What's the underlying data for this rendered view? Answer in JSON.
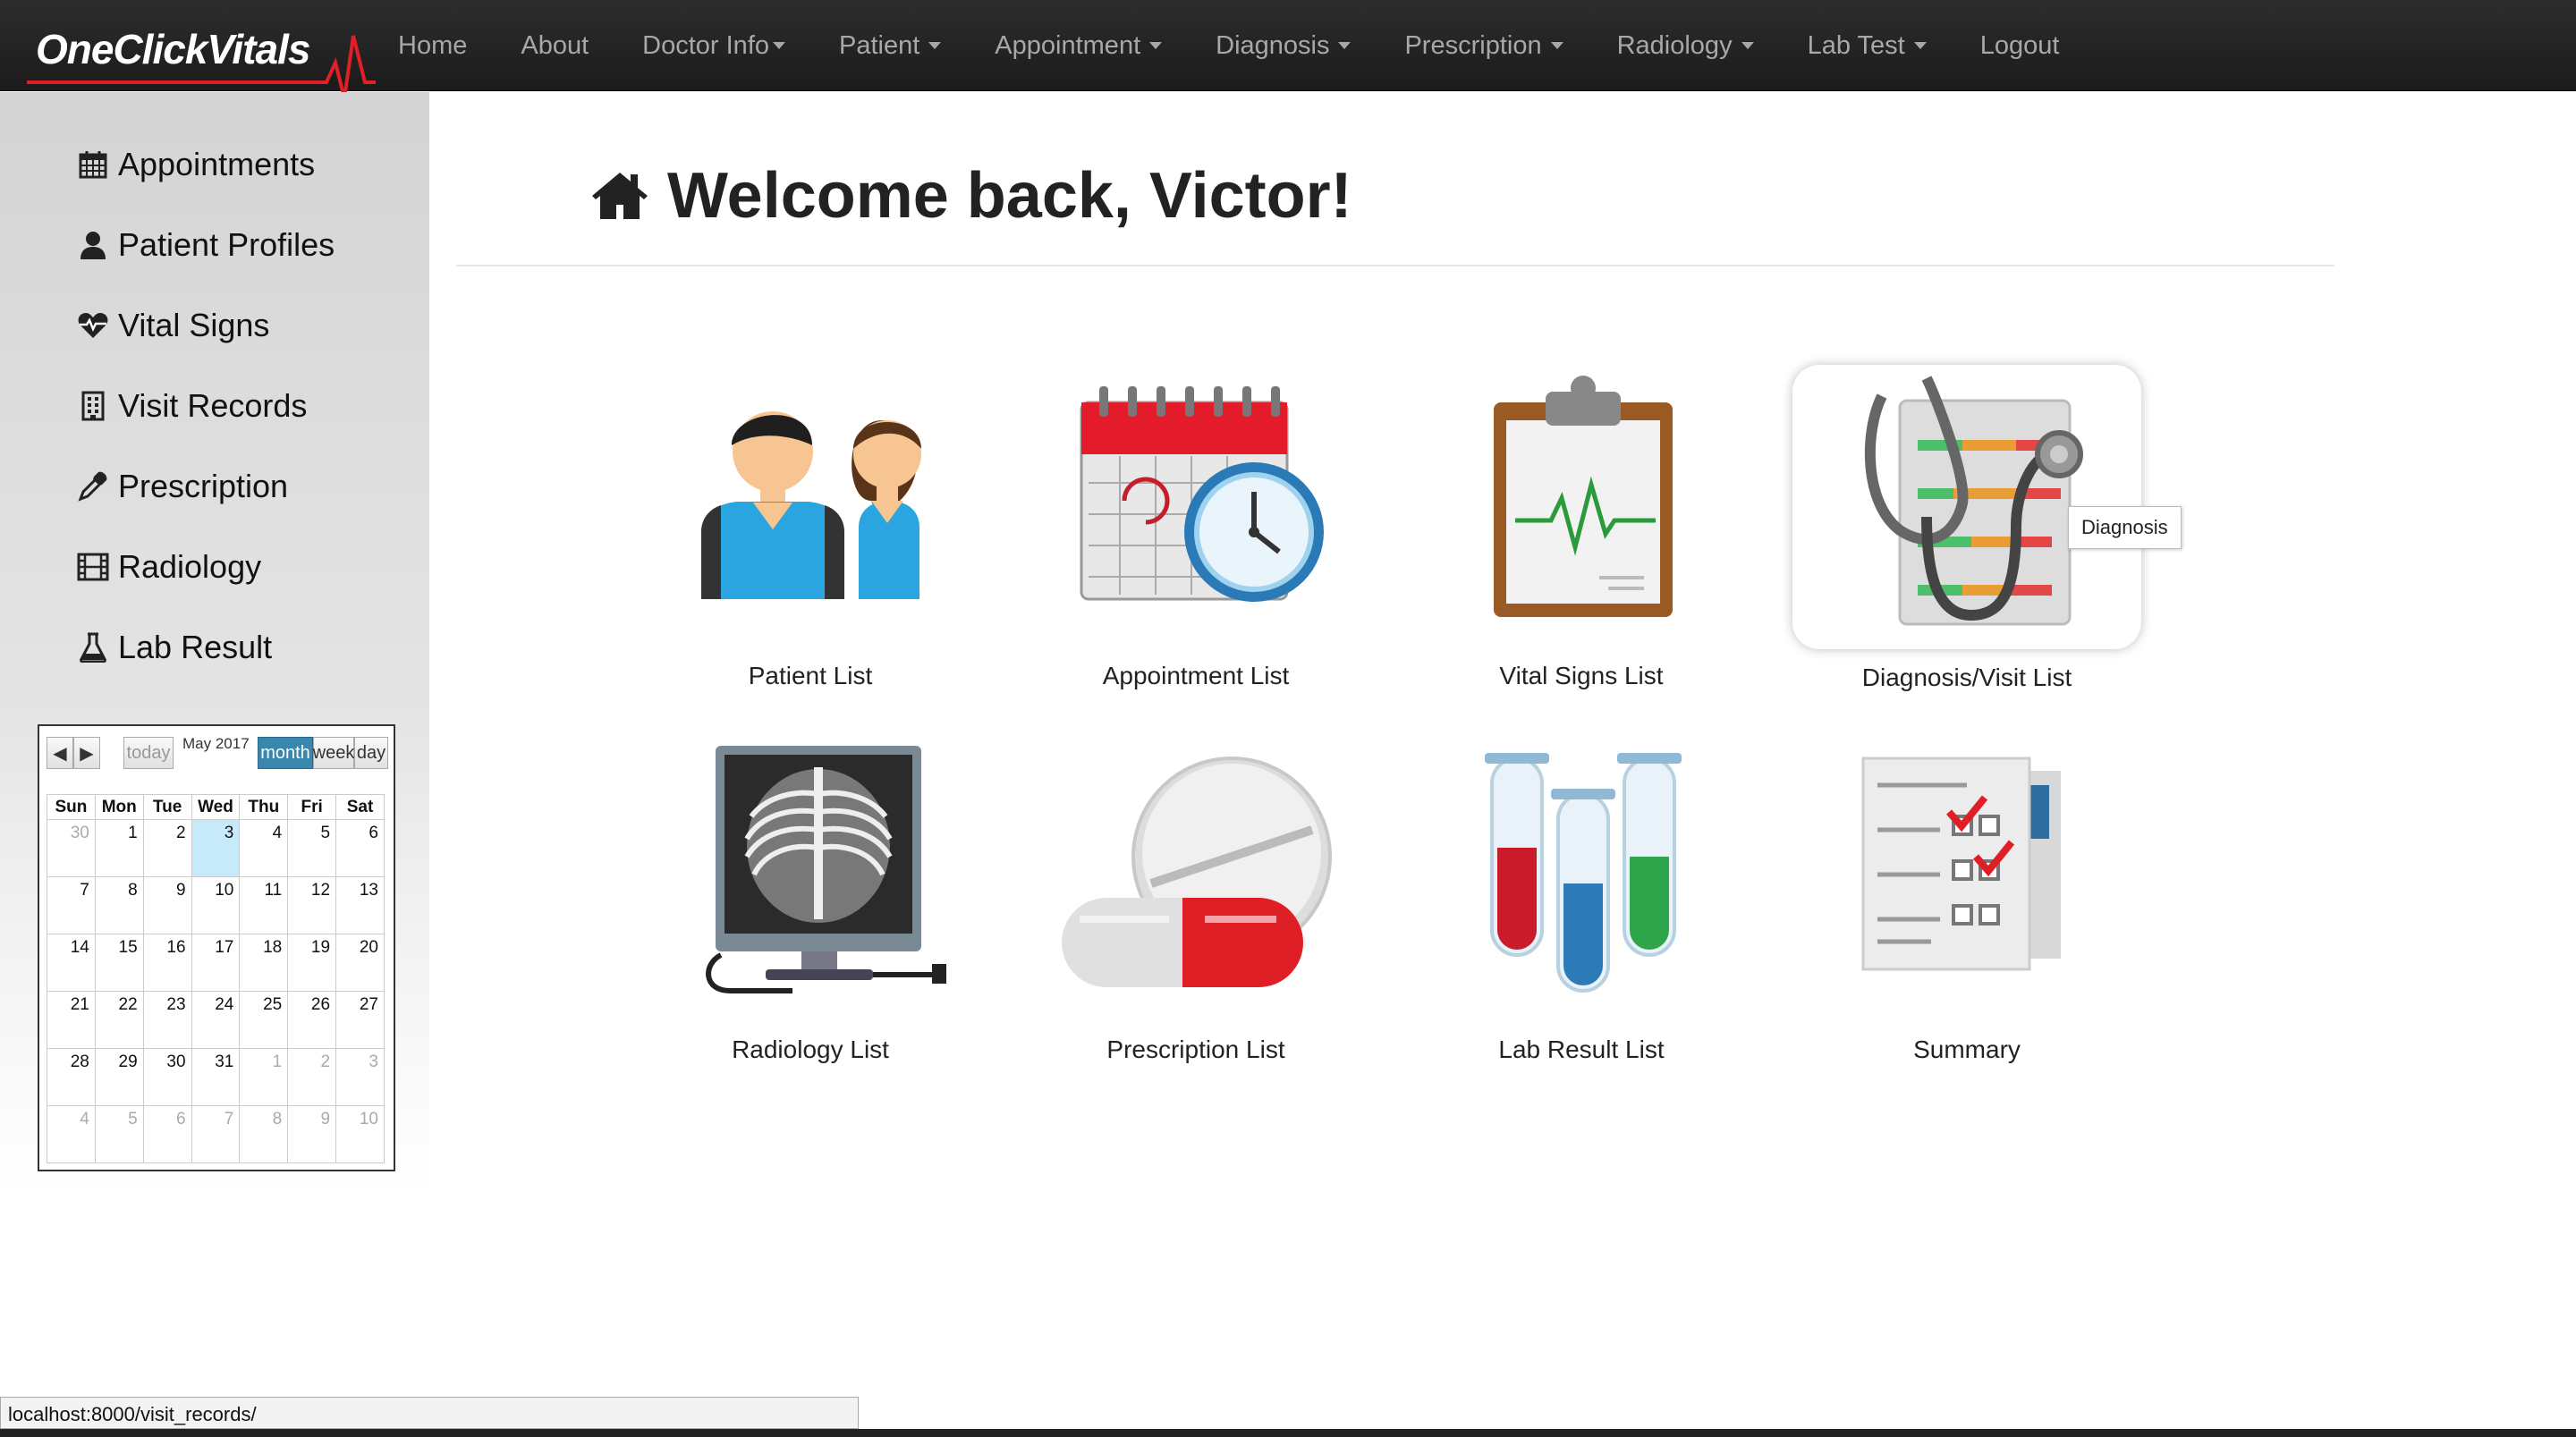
{
  "brand": {
    "name": "OneClickVitals"
  },
  "nav": {
    "items": [
      {
        "label": "Home",
        "dropdown": false
      },
      {
        "label": "About",
        "dropdown": false
      },
      {
        "label": "Doctor Info",
        "dropdown": true
      },
      {
        "label": "Patient",
        "dropdown": true
      },
      {
        "label": "Appointment",
        "dropdown": true
      },
      {
        "label": "Diagnosis",
        "dropdown": true
      },
      {
        "label": "Prescription",
        "dropdown": true
      },
      {
        "label": "Radiology",
        "dropdown": true
      },
      {
        "label": "Lab Test",
        "dropdown": true
      },
      {
        "label": "Logout",
        "dropdown": false
      }
    ]
  },
  "sidebar": {
    "items": [
      {
        "label": "Appointments",
        "icon": "calendar-icon"
      },
      {
        "label": "Patient Profiles",
        "icon": "user-icon"
      },
      {
        "label": "Vital Signs",
        "icon": "heartbeat-icon"
      },
      {
        "label": "Visit Records",
        "icon": "building-icon"
      },
      {
        "label": "Prescription",
        "icon": "eyedropper-icon"
      },
      {
        "label": "Radiology",
        "icon": "film-icon"
      },
      {
        "label": "Lab Result",
        "icon": "flask-icon"
      }
    ]
  },
  "calendar": {
    "title": "May 2017",
    "today_label": "today",
    "views": [
      "month",
      "week",
      "day"
    ],
    "active_view": "month",
    "weekdays": [
      "Sun",
      "Mon",
      "Tue",
      "Wed",
      "Thu",
      "Fri",
      "Sat"
    ],
    "weeks": [
      [
        "30",
        "1",
        "2",
        "3",
        "4",
        "5",
        "6"
      ],
      [
        "7",
        "8",
        "9",
        "10",
        "11",
        "12",
        "13"
      ],
      [
        "14",
        "15",
        "16",
        "17",
        "18",
        "19",
        "20"
      ],
      [
        "21",
        "22",
        "23",
        "24",
        "25",
        "26",
        "27"
      ],
      [
        "28",
        "29",
        "30",
        "31",
        "1",
        "2",
        "3"
      ],
      [
        "4",
        "5",
        "6",
        "7",
        "8",
        "9",
        "10"
      ]
    ],
    "today": "3"
  },
  "main": {
    "welcome": "Welcome back, Victor!",
    "tiles": [
      {
        "label": "Patient List",
        "icon": "patients-icon"
      },
      {
        "label": "Appointment List",
        "icon": "calendar-clock-icon"
      },
      {
        "label": "Vital Signs List",
        "icon": "clipboard-heartbeat-icon"
      },
      {
        "label": "Diagnosis/Visit List",
        "icon": "stethoscope-icon"
      },
      {
        "label": "Radiology List",
        "icon": "xray-monitor-icon"
      },
      {
        "label": "Prescription List",
        "icon": "pills-icon"
      },
      {
        "label": "Lab Result List",
        "icon": "test-tubes-icon"
      },
      {
        "label": "Summary",
        "icon": "checklist-icon"
      }
    ],
    "tooltip": "Diagnosis"
  },
  "status_bar": {
    "url": "localhost:8000/visit_records/"
  },
  "colors": {
    "accent": "#e21f26",
    "nav_bg": "#222222",
    "calendar_active": "#3a87ad",
    "today_bg": "#c7eafb"
  }
}
